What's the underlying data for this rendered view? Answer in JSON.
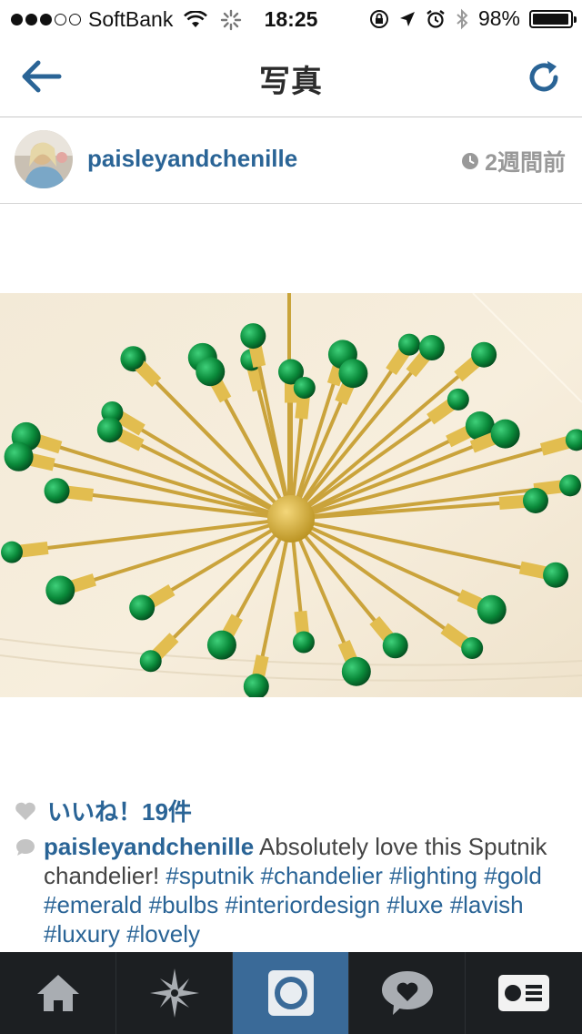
{
  "status_bar": {
    "carrier": "SoftBank",
    "time": "18:25",
    "battery": "98%",
    "battery_level": 0.98
  },
  "nav": {
    "title": "写真"
  },
  "post": {
    "username": "paisleyandchenille",
    "timestamp": "2週間前",
    "likes": "いいね！19件",
    "caption_user": "paisleyandchenille",
    "caption_text": " Absolutely love this Sputnik chandelier! ",
    "hashtags": [
      "#sputnik",
      "#chandelier",
      "#lighting",
      "#gold",
      "#emerald",
      "#bulbs",
      "#interiordesign",
      "#luxe",
      "#lavish",
      "#luxury",
      "#lovely"
    ]
  },
  "tabs": [
    {
      "name": "home",
      "icon": "home-icon"
    },
    {
      "name": "explore",
      "icon": "explore-star-icon"
    },
    {
      "name": "camera",
      "icon": "camera-icon"
    },
    {
      "name": "activity",
      "icon": "heart-bubble-icon"
    },
    {
      "name": "profile",
      "icon": "profile-card-icon"
    }
  ],
  "colors": {
    "accent": "#2a6496",
    "tab_active": "#3a6a98",
    "tab_bar": "#1c1f22",
    "muted": "#999999"
  }
}
